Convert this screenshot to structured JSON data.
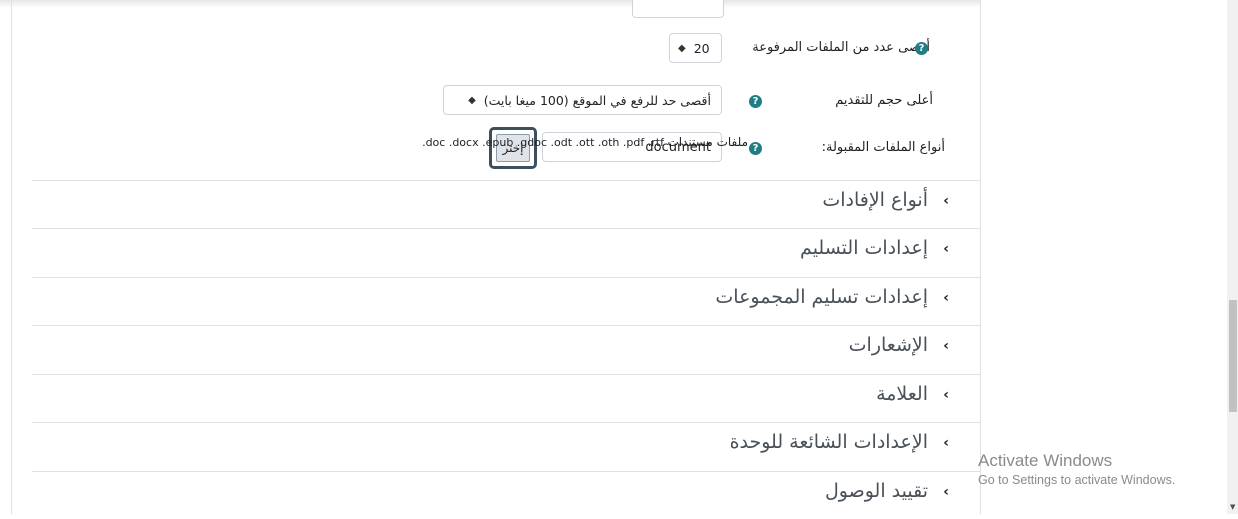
{
  "form": {
    "max_files": {
      "label": "أقصى عدد من الملفات المرفوعة",
      "value": "20"
    },
    "max_size": {
      "label": "أعلى حجم للتقديم",
      "value": "أقصى حد للرفع في الموقع (100  ميغا بايت)"
    },
    "accepted_types": {
      "label": "أنواع الملفات المقبولة:",
      "input_value": "document",
      "choose_label": "إختر",
      "types_name": "ملفات مستندات",
      "types_list": ".doc .docx .epub .gdoc .odt .ott .oth .pdf .rtf"
    }
  },
  "sections": [
    {
      "title": "أنواع الإفادات"
    },
    {
      "title": "إعدادات التسليم"
    },
    {
      "title": "إعدادات تسليم المجموعات"
    },
    {
      "title": "الإشعارات"
    },
    {
      "title": "العلامة"
    },
    {
      "title": "الإعدادات الشائعة للوحدة"
    },
    {
      "title": "تقييد الوصول"
    }
  ],
  "watermark": {
    "line1": "Activate Windows",
    "line2": "Go to Settings to activate Windows."
  },
  "icons": {
    "help": "question-circle-icon",
    "chevron": "chevron-left-icon",
    "updown": "updown-arrows-icon"
  },
  "colors": {
    "help_icon": "#1f7e84",
    "choose_border": "#3d4f5d"
  }
}
